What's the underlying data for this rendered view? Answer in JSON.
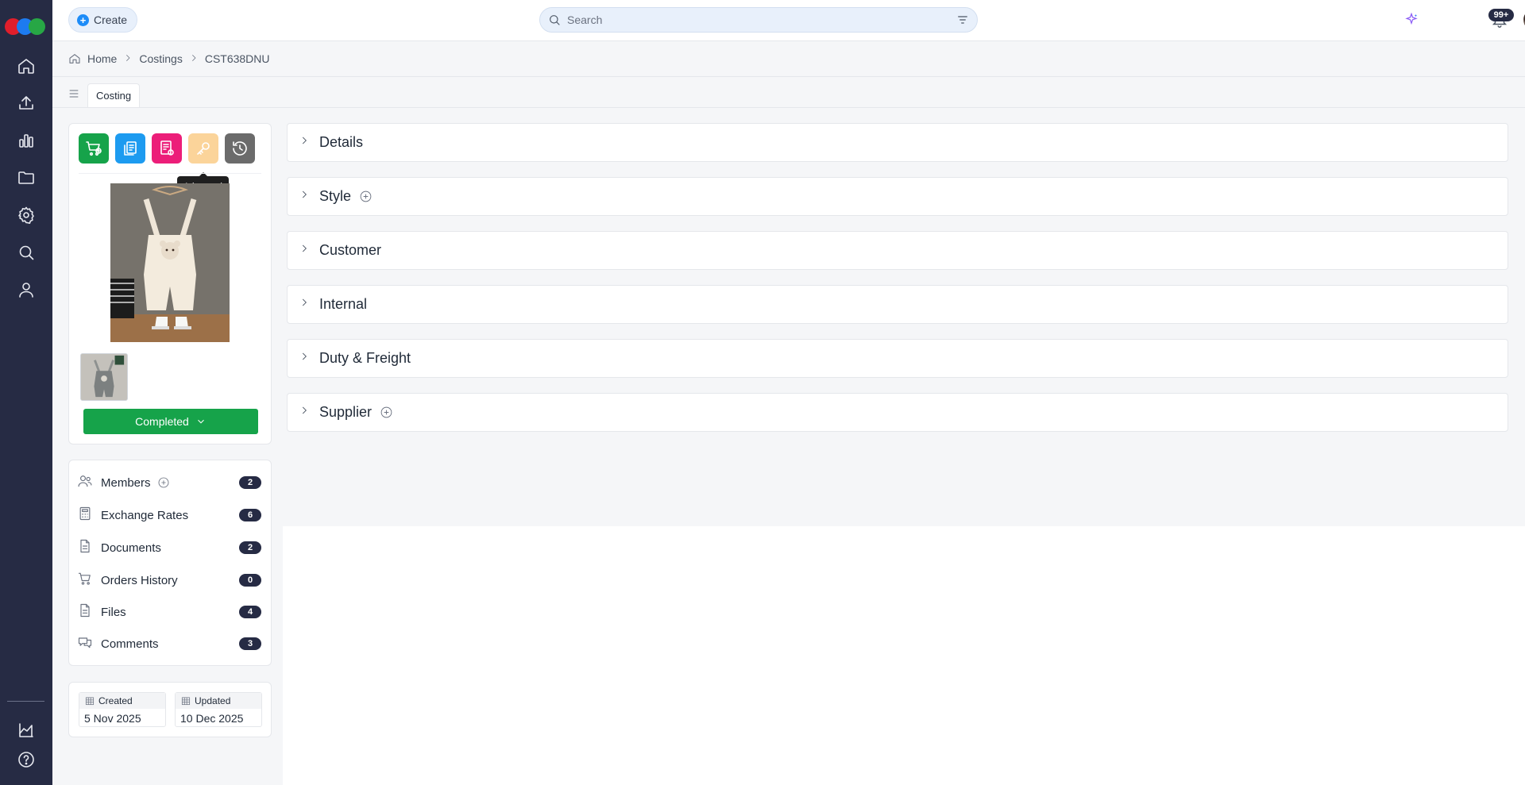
{
  "app": {
    "logo_colors": [
      "#e01e2b",
      "#1d7bf0",
      "#27a745"
    ],
    "rail_items": [
      "home-icon",
      "upload-icon",
      "chart-icon",
      "folder-icon",
      "settings-icon",
      "search-icon",
      "user-icon"
    ],
    "rail_bottom_items": [
      "analytics-icon",
      "help-icon"
    ]
  },
  "topbar": {
    "create_label": "Create",
    "search_placeholder": "Search",
    "notification_count": "99+"
  },
  "breadcrumb": {
    "home": "Home",
    "section": "Costings",
    "current": "CST638DNU"
  },
  "tabs": {
    "active": "Costing"
  },
  "actions": {
    "colors": [
      "#16a34a",
      "#1d9bf0",
      "#ec1e79",
      "#fbd49a",
      "#6b6b6b"
    ],
    "tooltip": "Advanced"
  },
  "status": {
    "label": "Completed",
    "color": "#16a34a"
  },
  "list": {
    "members": {
      "label": "Members",
      "count": "2"
    },
    "exchange_rates": {
      "label": "Exchange Rates",
      "count": "6"
    },
    "documents": {
      "label": "Documents",
      "count": "2"
    },
    "orders_history": {
      "label": "Orders History",
      "count": "0"
    },
    "files": {
      "label": "Files",
      "count": "4"
    },
    "comments": {
      "label": "Comments",
      "count": "3"
    }
  },
  "dates": {
    "created_label": "Created",
    "created_value": "5 Nov 2025",
    "updated_label": "Updated",
    "updated_value": "10 Dec 2025"
  },
  "sections": {
    "details": "Details",
    "style": "Style",
    "customer": "Customer",
    "internal": "Internal",
    "duty_freight": "Duty & Freight",
    "supplier": "Supplier"
  }
}
